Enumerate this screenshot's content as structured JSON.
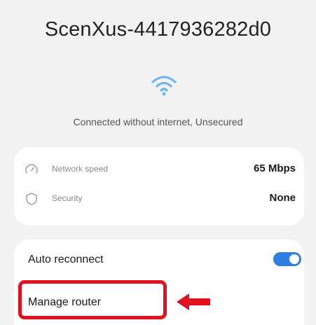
{
  "header": {
    "network_name": "ScenXus-4417936282d0",
    "status": "Connected without internet, Unsecured"
  },
  "icons": {
    "wifi": "wifi-icon",
    "speed": "speedometer-icon",
    "security": "shield-icon",
    "annotation": "arrow-left-icon"
  },
  "details": {
    "network_speed": {
      "label": "Network speed",
      "value": "65 Mbps"
    },
    "security": {
      "label": "Security",
      "value": "None"
    }
  },
  "settings": {
    "auto_reconnect": {
      "label": "Auto reconnect",
      "enabled": true
    },
    "manage_router": {
      "label": "Manage router"
    }
  },
  "colors": {
    "accent": "#2f7fe0",
    "wifi": "#6fb6ea",
    "highlight": "#e3101f",
    "background": "#f2f2f2"
  }
}
